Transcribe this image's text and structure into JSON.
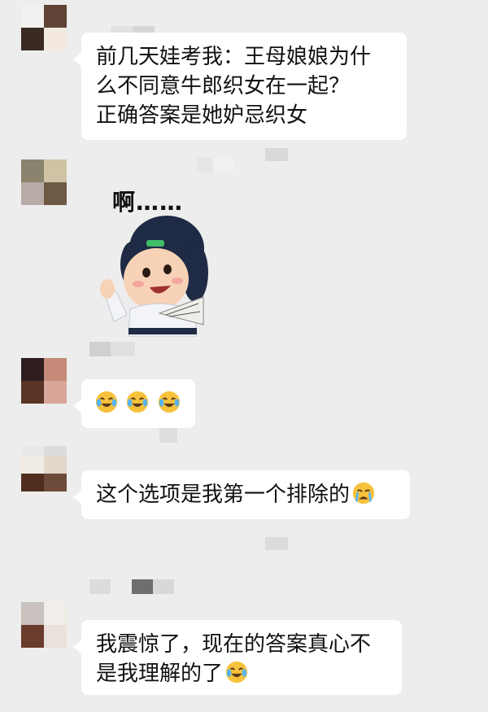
{
  "messages": [
    {
      "type": "text",
      "lines": [
        "前几天娃考我：王母娘娘为什",
        "么不同意牛郎织女在一起？",
        "正确答案是她妒忌织女"
      ]
    },
    {
      "type": "sticker",
      "sticker_text": "啊……"
    },
    {
      "type": "emoji-only",
      "emojis": [
        "crying-laughing-face",
        "crying-laughing-face",
        "crying-laughing-face"
      ]
    },
    {
      "type": "text",
      "lines": [
        "这个选项是我第一个排除的"
      ],
      "trailing_emoji": "crying-face"
    },
    {
      "type": "text",
      "lines": [
        "我震惊了，现在的答案真心不",
        "是我理解的了"
      ],
      "trailing_emoji": "crying-laughing-face"
    }
  ],
  "colors": {
    "background": "#ededed",
    "bubble": "#ffffff",
    "text": "#111111",
    "emoji_yellow": "#f7c23b"
  }
}
